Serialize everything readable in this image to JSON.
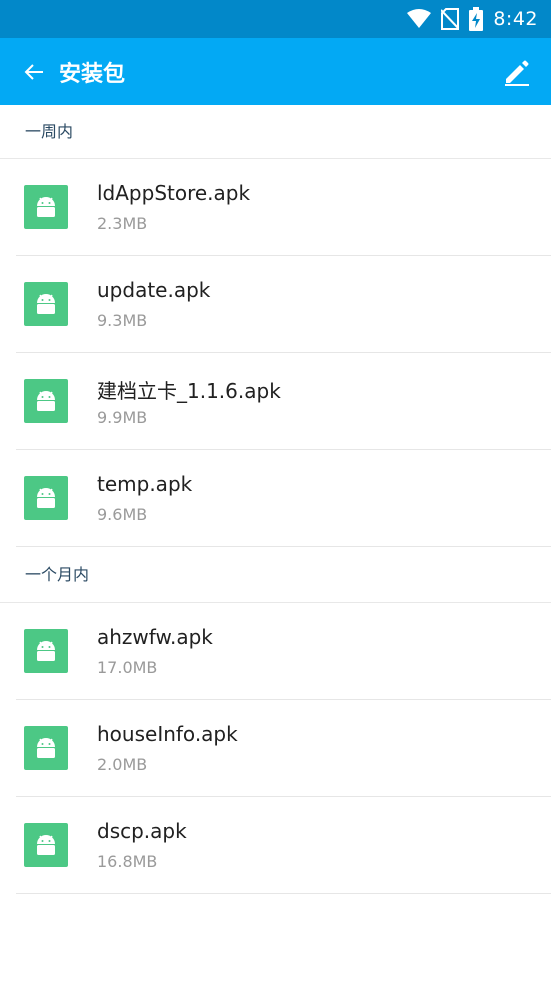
{
  "status_bar": {
    "time": "8:42",
    "icons": [
      "wifi-icon",
      "no-sim-icon",
      "battery-charging-icon"
    ]
  },
  "app_bar": {
    "title": "安装包",
    "icons": [
      "back-arrow-icon",
      "edit-pencil-icon"
    ]
  },
  "colors": {
    "status_bar": "#0288c9",
    "app_bar": "#03a9f4",
    "apk_icon": "#4cc885",
    "section_header_text": "#2b4a63"
  },
  "sections": [
    {
      "header": "一周内",
      "items": [
        {
          "name": "ldAppStore.apk",
          "size": "2.3MB",
          "icon": "android-apk-icon"
        },
        {
          "name": "update.apk",
          "size": "9.3MB",
          "icon": "android-apk-icon"
        },
        {
          "name": "建档立卡_1.1.6.apk",
          "size": "9.9MB",
          "icon": "android-apk-icon"
        },
        {
          "name": "temp.apk",
          "size": "9.6MB",
          "icon": "android-apk-icon"
        }
      ]
    },
    {
      "header": "一个月内",
      "items": [
        {
          "name": "ahzwfw.apk",
          "size": "17.0MB",
          "icon": "android-apk-icon"
        },
        {
          "name": "houseInfo.apk",
          "size": "2.0MB",
          "icon": "android-apk-icon"
        },
        {
          "name": "dscp.apk",
          "size": "16.8MB",
          "icon": "android-apk-icon"
        }
      ]
    }
  ]
}
